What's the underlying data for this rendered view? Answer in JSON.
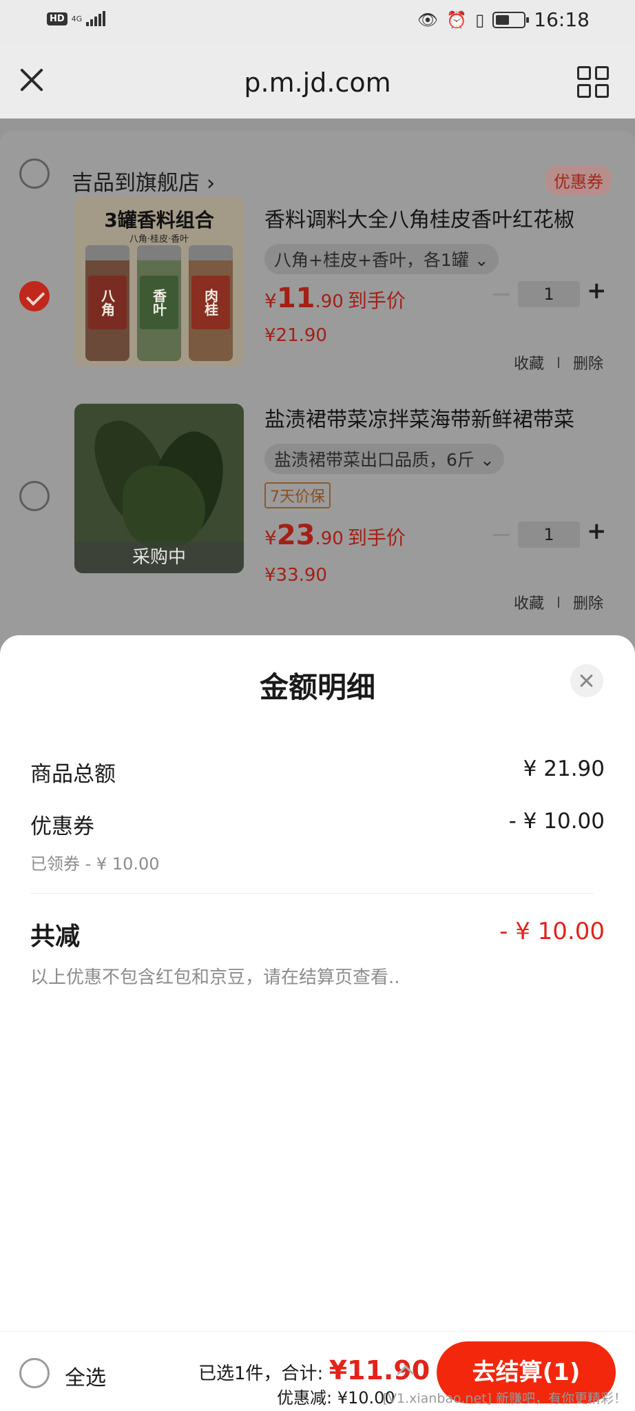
{
  "status_bar": {
    "hd": "HD",
    "network": "4G",
    "time": "16:18",
    "battery_level": 0.5
  },
  "browser": {
    "url": "p.m.jd.com"
  },
  "cart": {
    "shop_name": "吉品到旗舰店",
    "shop_chevron": "›",
    "coupon_badge": "优惠券",
    "items": [
      {
        "thumb_title": "3罐香料组合",
        "thumb_subtitle": "八角·桂皮·香叶",
        "jar_labels": [
          "八角",
          "香叶",
          "肉桂"
        ],
        "title": "香料调料大全八角桂皮香叶红花椒",
        "spec": "八角+桂皮+香叶，各1罐 ⌄",
        "price_yen": "¥",
        "price_int": "11",
        "price_dec": ".90",
        "price_label": "到手价",
        "orig_price": "¥21.90",
        "qty": "1",
        "checked": true
      },
      {
        "thumb_overlay": "采购中",
        "title": "盐渍裙带菜凉拌菜海带新鲜裙带菜",
        "spec": "盐渍裙带菜出口品质，6斤 ⌄",
        "tag": "7天价保",
        "price_yen": "¥",
        "price_int": "23",
        "price_dec": ".90",
        "price_label": "到手价",
        "orig_price": "¥33.90",
        "qty": "1",
        "checked": false
      }
    ],
    "qty_plus": "+",
    "favorite": "收藏",
    "delete": "删除"
  },
  "sheet": {
    "title": "金额明细",
    "goods_total_label": "商品总额",
    "goods_total_value": "¥ 21.90",
    "coupon_label": "优惠券",
    "coupon_value": "- ¥ 10.00",
    "coupon_note": "已领券 - ¥ 10.00",
    "total_discount_label": "共减",
    "total_discount_value": "- ¥ 10.00",
    "note": "以上优惠不包含红包和京豆，请在结算页查看.."
  },
  "bottom_bar": {
    "select_all": "全选",
    "selected_summary": "已选1件，合计:",
    "total_amount": "¥11.90",
    "discount": "优惠减: ¥10.00",
    "checkout": "去结算(1)",
    "watermark": "[V1.xianbao.net] 新赚吧，有你更精彩！"
  },
  "colors": {
    "accent_red": "#e2231a",
    "checkout_bg": "#f2270c",
    "overlay_gray": "#9b9b9b"
  }
}
